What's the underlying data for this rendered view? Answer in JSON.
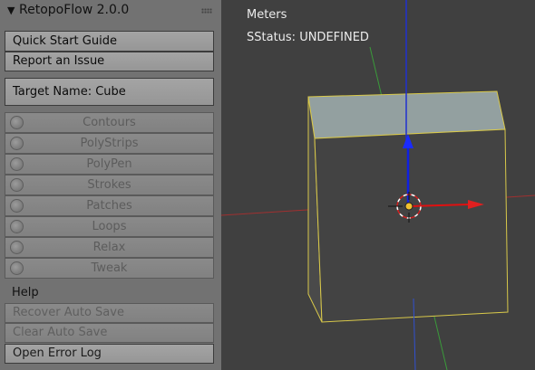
{
  "panel": {
    "title": "RetopoFlow 2.0.0",
    "buttons": {
      "quick_start": "Quick Start Guide",
      "report_issue": "Report an Issue",
      "target_name": "Target Name: Cube"
    },
    "tools": [
      {
        "label": "Contours",
        "icon": "contours-icon"
      },
      {
        "label": "PolyStrips",
        "icon": "polystrips-icon"
      },
      {
        "label": "PolyPen",
        "icon": "polypen-icon"
      },
      {
        "label": "Strokes",
        "icon": "strokes-icon"
      },
      {
        "label": "Patches",
        "icon": "patches-icon"
      },
      {
        "label": "Loops",
        "icon": "loops-icon"
      },
      {
        "label": "Relax",
        "icon": "relax-icon"
      },
      {
        "label": "Tweak",
        "icon": "tweak-icon"
      }
    ],
    "help": {
      "label": "Help",
      "recover": "Recover Auto Save",
      "clear": "Clear Auto Save",
      "error_log": "Open Error Log"
    }
  },
  "viewport": {
    "units": "Meters",
    "status": "SStatus: UNDEFINED"
  },
  "colors": {
    "panel_bg": "#727272",
    "viewport_bg": "#404040",
    "selection_outline": "#d8c84a",
    "axis_x": "#c03030",
    "axis_y": "#3aa03a",
    "axis_z": "#2030d0"
  }
}
